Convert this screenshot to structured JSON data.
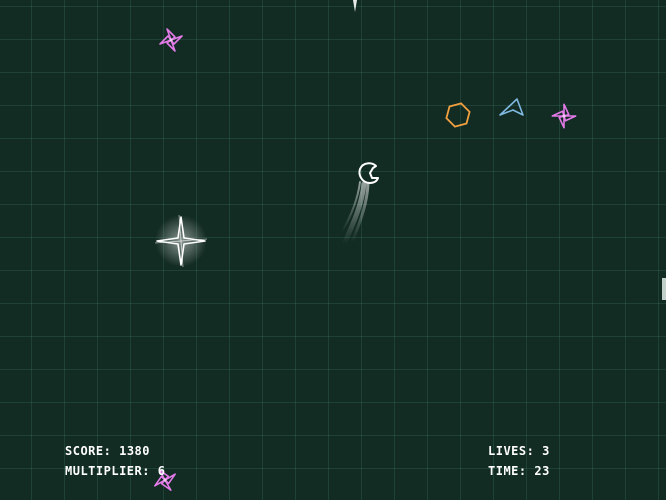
{
  "hud": {
    "score_label": "SCORE:",
    "score": "1380",
    "multiplier_label": "MULTIPLIER:",
    "multiplier": "6",
    "lives_label": "LIVES:",
    "lives": "3",
    "time_label": "TIME:",
    "time": "23"
  },
  "colors": {
    "background": "#122b23",
    "grid": "#2f5a4c",
    "pinwheel": "#e27ae8",
    "hexagon": "#f0a040",
    "dart": "#7fb8e0",
    "player": "#ffffff",
    "hud_text": "#ffffff"
  },
  "entities": [
    {
      "type": "pinwheel-enemy",
      "color": "pinwheel"
    },
    {
      "type": "pinwheel-enemy",
      "color": "pinwheel"
    },
    {
      "type": "pinwheel-enemy",
      "color": "pinwheel"
    },
    {
      "type": "hexagon-enemy",
      "color": "hexagon"
    },
    {
      "type": "dart-enemy",
      "color": "dart"
    },
    {
      "type": "player-ship",
      "color": "player"
    },
    {
      "type": "star-burst",
      "color": "player"
    }
  ]
}
